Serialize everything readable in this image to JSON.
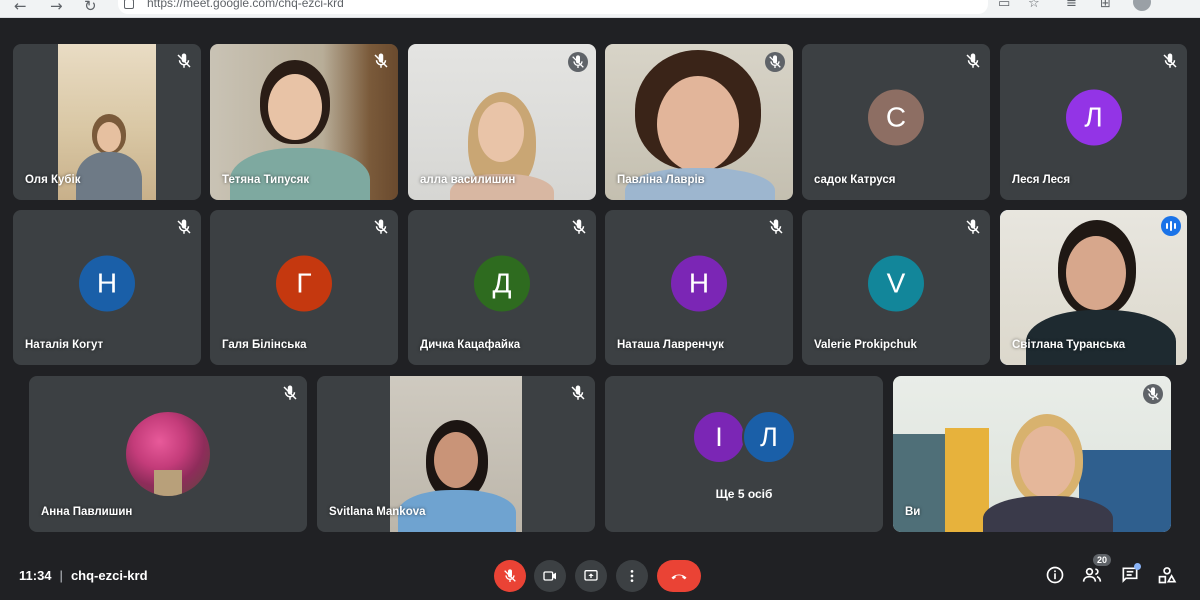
{
  "browser": {
    "url": "https://meet.google.com/chq-ezci-krd"
  },
  "tiles": [
    {
      "name": "Оля Кубік"
    },
    {
      "name": "Тетяна Типусяк"
    },
    {
      "name": "алла василишин"
    },
    {
      "name": "Павліна Лаврів"
    },
    {
      "name": "садок Катруся",
      "initial": "С",
      "color": "#8d6e63"
    },
    {
      "name": "Леся Леся",
      "initial": "Л",
      "color": "#9334e6"
    },
    {
      "name": "Наталія Когут",
      "initial": "Н",
      "color": "#1a5fa8"
    },
    {
      "name": "Галя Білінська",
      "initial": "Г",
      "color": "#c5380f"
    },
    {
      "name": "Дичка Кацафайка",
      "initial": "Д",
      "color": "#2e6b1f"
    },
    {
      "name": "Наташа Лавренчук",
      "initial": "Н",
      "color": "#7b26b5"
    },
    {
      "name": "Valerie Prokipchuk",
      "initial": "V",
      "color": "#12869a"
    },
    {
      "name": "Світлана Туранська"
    },
    {
      "name": "Анна Павлишин"
    },
    {
      "name": "Svitlana Mankova"
    },
    {
      "name": "Ви"
    }
  ],
  "more": {
    "label": "Ще 5 осіб",
    "avatars": [
      {
        "initial": "І",
        "color": "#7b26b5"
      },
      {
        "initial": "Л",
        "color": "#1a5fa8"
      }
    ]
  },
  "meeting": {
    "time": "11:34",
    "separator": "|",
    "code": "chq-ezci-krd",
    "participants_count": "20"
  },
  "icons": {
    "mic_off": "mic-off-icon",
    "camera": "camera-icon",
    "present": "present-screen-icon",
    "more": "more-options-icon",
    "end_call": "end-call-icon",
    "info": "info-icon",
    "people": "people-icon",
    "chat": "chat-icon",
    "activities": "activities-icon"
  },
  "colors": {
    "background": "#202124",
    "tile": "#3c4043",
    "red": "#ea4335",
    "speaking": "#8ab4f8"
  }
}
